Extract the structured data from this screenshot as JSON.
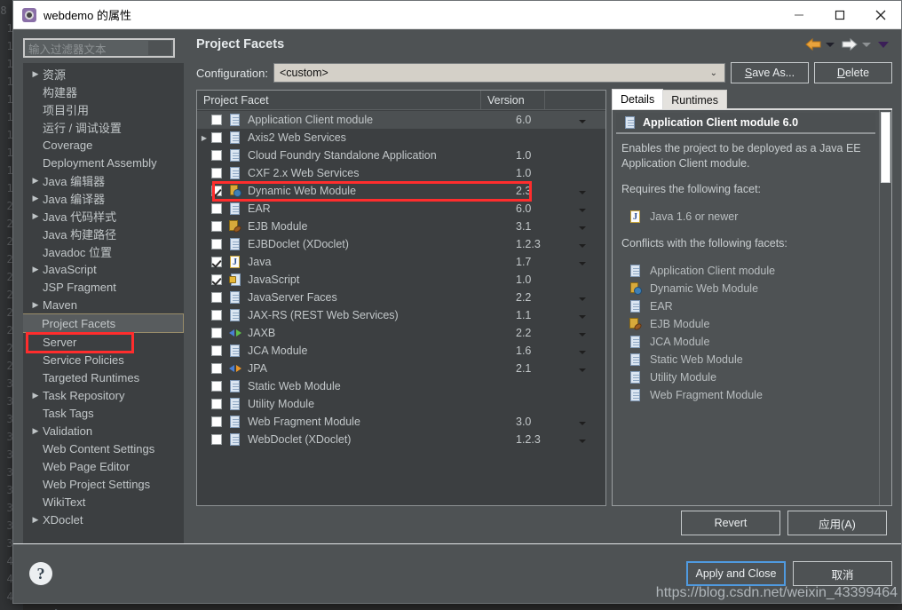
{
  "window": {
    "title": "webdemo 的属性",
    "app_icon": "gear-icon",
    "minimize": "—",
    "maximize": "□",
    "close": "✕"
  },
  "sidebar": {
    "filter_placeholder": "输入过滤器文本",
    "filter_value": "",
    "items": [
      {
        "label": "资源",
        "expandable": true
      },
      {
        "label": "构建器",
        "expandable": false
      },
      {
        "label": "项目引用",
        "expandable": false
      },
      {
        "label": "运行 / 调试设置",
        "expandable": false
      },
      {
        "label": "Coverage",
        "expandable": false
      },
      {
        "label": "Deployment Assembly",
        "expandable": false
      },
      {
        "label": "Java 编辑器",
        "expandable": true
      },
      {
        "label": "Java 编译器",
        "expandable": true
      },
      {
        "label": "Java 代码样式",
        "expandable": true
      },
      {
        "label": "Java 构建路径",
        "expandable": false
      },
      {
        "label": "Javadoc 位置",
        "expandable": false
      },
      {
        "label": "JavaScript",
        "expandable": true
      },
      {
        "label": "JSP Fragment",
        "expandable": false
      },
      {
        "label": "Maven",
        "expandable": true
      },
      {
        "label": "Project Facets",
        "expandable": false,
        "selected": true
      },
      {
        "label": "Server",
        "expandable": false
      },
      {
        "label": "Service Policies",
        "expandable": false
      },
      {
        "label": "Targeted Runtimes",
        "expandable": false
      },
      {
        "label": "Task Repository",
        "expandable": true
      },
      {
        "label": "Task Tags",
        "expandable": false
      },
      {
        "label": "Validation",
        "expandable": true
      },
      {
        "label": "Web Content Settings",
        "expandable": false
      },
      {
        "label": "Web Page Editor",
        "expandable": false
      },
      {
        "label": "Web Project Settings",
        "expandable": false
      },
      {
        "label": "WikiText",
        "expandable": false
      },
      {
        "label": "XDoclet",
        "expandable": true
      }
    ]
  },
  "page": {
    "title": "Project Facets",
    "nav_back_icon": "back-arrow-icon",
    "nav_forward_icon": "forward-arrow-icon",
    "nav_menu_icon": "chevron-down-icon"
  },
  "configuration": {
    "label": "Configuration:",
    "value": "<custom>",
    "save_as_button": "Save As...",
    "save_as_mnemonic": "S",
    "delete_button": "Delete",
    "delete_mnemonic": "D"
  },
  "facet_table": {
    "columns": [
      "Project Facet",
      "Version",
      ""
    ],
    "rows": [
      {
        "name": "Application Client module",
        "version": "6.0",
        "checked": false,
        "expandable": false,
        "icon": "document-icon",
        "caret": true,
        "selected": true
      },
      {
        "name": "Axis2 Web Services",
        "version": "",
        "checked": false,
        "expandable": true,
        "icon": "document-icon",
        "caret": false
      },
      {
        "name": "Cloud Foundry Standalone Application",
        "version": "1.0",
        "checked": false,
        "expandable": false,
        "icon": "document-icon",
        "caret": false
      },
      {
        "name": "CXF 2.x Web Services",
        "version": "1.0",
        "checked": false,
        "expandable": false,
        "icon": "document-icon",
        "caret": false
      },
      {
        "name": "Dynamic Web Module",
        "version": "2.3",
        "checked": true,
        "expandable": false,
        "icon": "web-module-icon",
        "caret": true,
        "highlighted": true
      },
      {
        "name": "EAR",
        "version": "6.0",
        "checked": false,
        "expandable": false,
        "icon": "document-icon",
        "caret": true
      },
      {
        "name": "EJB Module",
        "version": "3.1",
        "checked": false,
        "expandable": false,
        "icon": "ejb-icon",
        "caret": true
      },
      {
        "name": "EJBDoclet (XDoclet)",
        "version": "1.2.3",
        "checked": false,
        "expandable": false,
        "icon": "document-icon",
        "caret": true
      },
      {
        "name": "Java",
        "version": "1.7",
        "checked": true,
        "expandable": false,
        "icon": "java-icon",
        "caret": true
      },
      {
        "name": "JavaScript",
        "version": "1.0",
        "checked": true,
        "expandable": false,
        "icon": "javascript-icon",
        "caret": false
      },
      {
        "name": "JavaServer Faces",
        "version": "2.2",
        "checked": false,
        "expandable": false,
        "icon": "document-icon",
        "caret": true
      },
      {
        "name": "JAX-RS (REST Web Services)",
        "version": "1.1",
        "checked": false,
        "expandable": false,
        "icon": "document-icon",
        "caret": true
      },
      {
        "name": "JAXB",
        "version": "2.2",
        "checked": false,
        "expandable": false,
        "icon": "jaxb-icon",
        "caret": true
      },
      {
        "name": "JCA Module",
        "version": "1.6",
        "checked": false,
        "expandable": false,
        "icon": "document-icon",
        "caret": true
      },
      {
        "name": "JPA",
        "version": "2.1",
        "checked": false,
        "expandable": false,
        "icon": "jpa-icon",
        "caret": true
      },
      {
        "name": "Static Web Module",
        "version": "",
        "checked": false,
        "expandable": false,
        "icon": "document-icon",
        "caret": false
      },
      {
        "name": "Utility Module",
        "version": "",
        "checked": false,
        "expandable": false,
        "icon": "document-icon",
        "caret": false
      },
      {
        "name": "Web Fragment Module",
        "version": "3.0",
        "checked": false,
        "expandable": false,
        "icon": "document-icon",
        "caret": true
      },
      {
        "name": "WebDoclet (XDoclet)",
        "version": "1.2.3",
        "checked": false,
        "expandable": false,
        "icon": "document-icon",
        "caret": true
      }
    ]
  },
  "details": {
    "tabs": [
      {
        "label": "Details",
        "active": true
      },
      {
        "label": "Runtimes",
        "active": false
      }
    ],
    "header": "Application Client module 6.0",
    "header_icon": "document-icon",
    "description": "Enables the project to be deployed as a Java EE Application Client module.",
    "requires_label": "Requires the following facet:",
    "requires": [
      {
        "label": "Java 1.6 or newer",
        "icon": "java-icon"
      }
    ],
    "conflicts_label": "Conflicts with the following facets:",
    "conflicts": [
      {
        "label": "Application Client module",
        "icon": "document-icon"
      },
      {
        "label": "Dynamic Web Module",
        "icon": "web-module-icon"
      },
      {
        "label": "EAR",
        "icon": "document-icon"
      },
      {
        "label": "EJB Module",
        "icon": "ejb-icon"
      },
      {
        "label": "JCA Module",
        "icon": "document-icon"
      },
      {
        "label": "Static Web Module",
        "icon": "document-icon"
      },
      {
        "label": "Utility Module",
        "icon": "document-icon"
      },
      {
        "label": "Web Fragment Module",
        "icon": "document-icon"
      }
    ]
  },
  "buttons": {
    "revert": "Revert",
    "apply": "应用(A)",
    "apply_and_close": "Apply and Close",
    "cancel": "取消",
    "help_icon": "question-mark-icon"
  },
  "watermark": "https://blog.csdn.net/weixin_43399464",
  "colors": {
    "highlight": "#ff2d2d",
    "dialog_bg": "#4e5254",
    "tree_bg": "#3c3f41",
    "focus_border": "#4f9ae0",
    "accent_orange": "#e8962a"
  }
}
